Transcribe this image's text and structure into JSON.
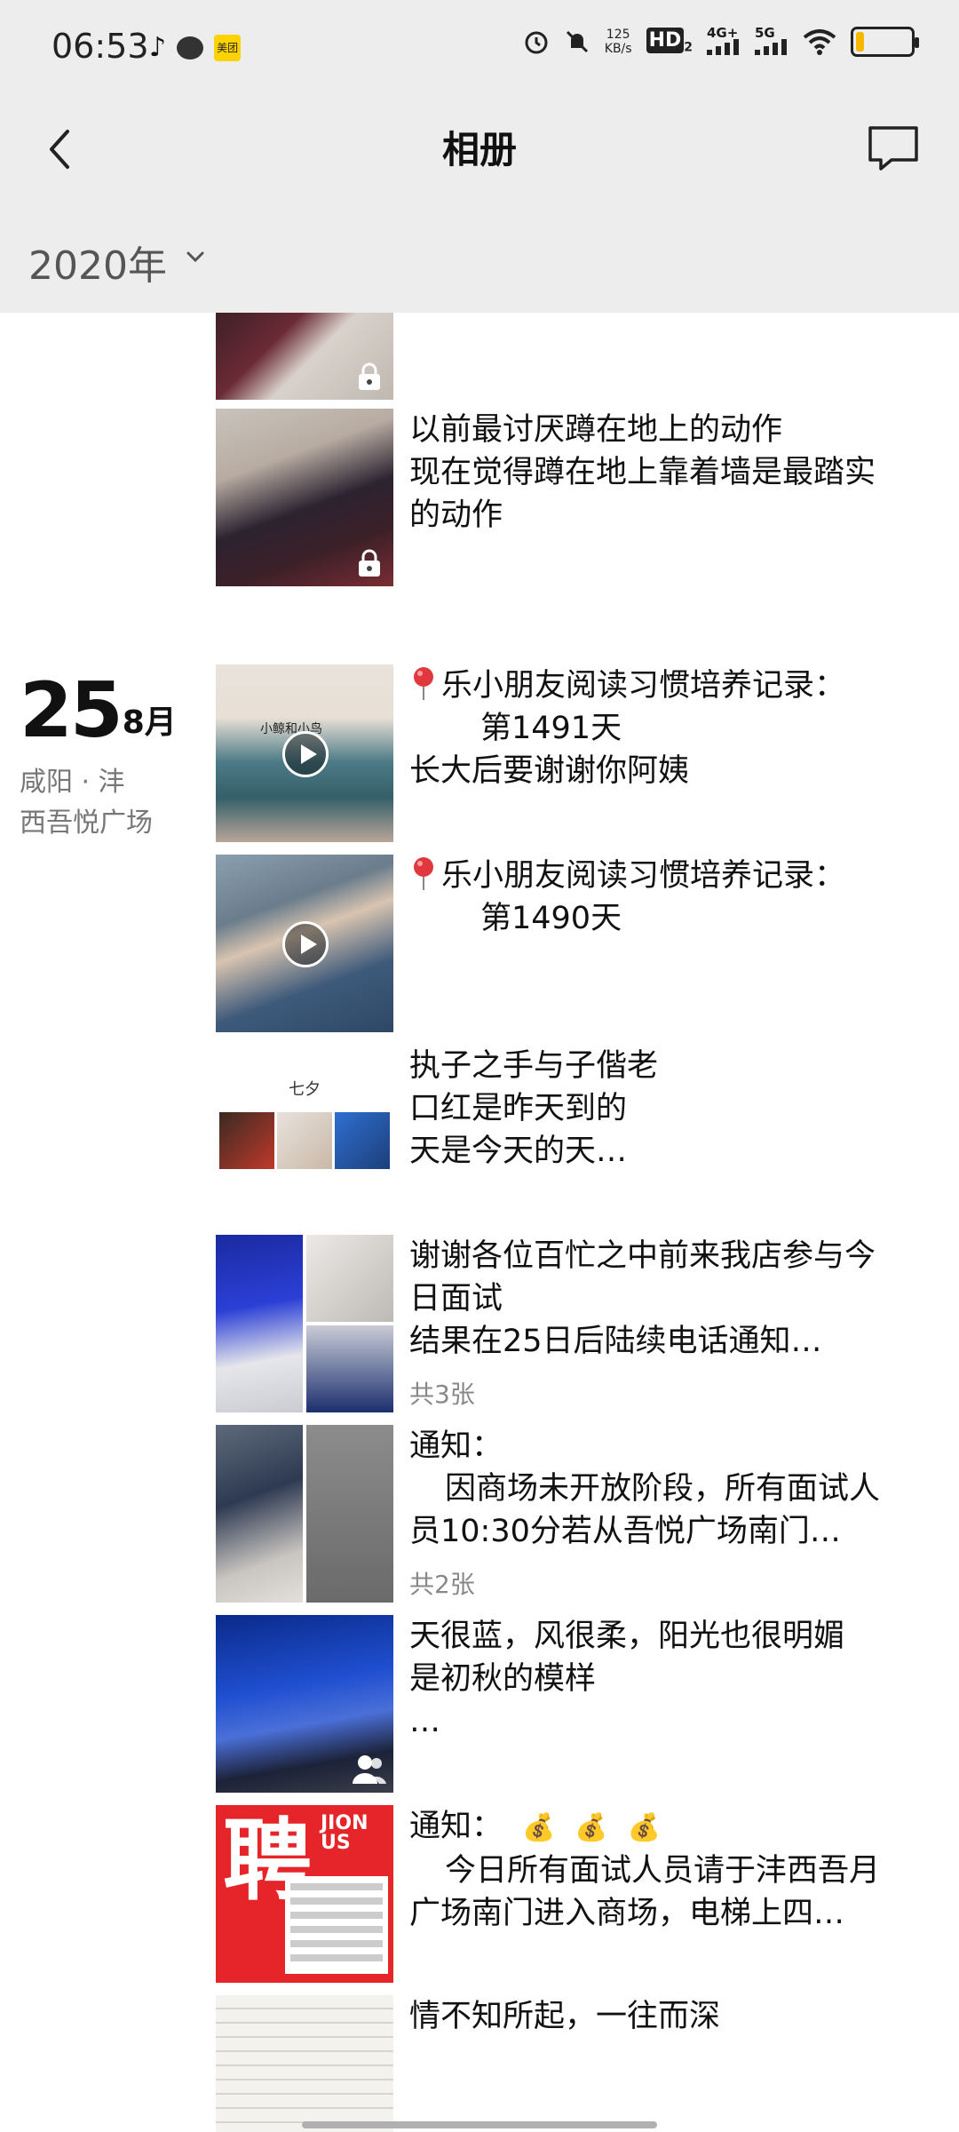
{
  "status_bar": {
    "time": "06:53",
    "net_speed_value": "125",
    "net_speed_unit": "KB/s",
    "hd_label": "HD",
    "hd_sub": "2",
    "network_4g": "4G+",
    "network_5g": "5G",
    "battery_level_percent": 15,
    "app_icons": [
      "tiktok-icon",
      "message-icon",
      "meituan-icon"
    ],
    "meituan_label": "美团",
    "right_icons": [
      "alarm-icon",
      "mute-icon",
      "hd-icon",
      "signal-4g-icon",
      "signal-5g-icon",
      "wifi-icon",
      "battery-icon"
    ]
  },
  "nav": {
    "title": "相册",
    "back_icon": "back-arrow-icon",
    "chat_icon": "chat-icon"
  },
  "year_filter": {
    "label": "2020年",
    "icon": "chevron-down-icon"
  },
  "date_group": {
    "day": "25",
    "month": "8月",
    "location_line1": "咸阳 · 沣",
    "location_line2": "西吾悦广场"
  },
  "entries": [
    {
      "lines": [],
      "thumb": "photo",
      "locked": true
    },
    {
      "lines": [
        "以前最讨厌蹲在地上的动作",
        "现在觉得蹲在地上靠着墙是最踏实",
        "的动作"
      ],
      "thumb": "photo",
      "locked": true
    },
    {
      "lines": [
        "乐小朋友阅读习惯培养记录：",
        "第1491天",
        "长大后要谢谢你阿姨"
      ],
      "thumb": "video",
      "book_title": "小鲸和小鸟"
    },
    {
      "lines": [
        "乐小朋友阅读习惯培养记录：",
        "第1490天"
      ],
      "thumb": "video"
    },
    {
      "lines": [
        "执子之手与子偕老",
        "口红是昨天到的",
        "天是今天的天…"
      ],
      "thumb": "qixi",
      "qixi_title": "七夕"
    },
    {
      "lines": [
        "谢谢各位百忙之中前来我店参与今",
        "日面试",
        "结果在25日后陆续电话通知…"
      ],
      "count": "共3张",
      "thumb": "grid3"
    },
    {
      "lines": [
        "通知：",
        "因商场未开放阶段，所有面试人",
        "员10:30分若从吾悦广场南门…"
      ],
      "count": "共2张",
      "thumb": "grid2"
    },
    {
      "lines": [
        "天很蓝，风很柔，阳光也很明媚",
        "是初秋的模样",
        "…"
      ],
      "thumb": "photo-shared"
    },
    {
      "lines": [
        "通知：",
        "今日所有面试人员请于沣西吾月",
        "广场南门进入商场，电梯上四…"
      ],
      "thumb": "recruit",
      "recruit_char": "聘",
      "recruit_join": "JIONUS",
      "money_icons": [
        "money-bag-icon",
        "money-bag-icon",
        "money-bag-icon"
      ],
      "money_glyph": "💰"
    },
    {
      "lines": [
        "情不知所起，一往而深"
      ],
      "thumb": "text-image"
    }
  ]
}
